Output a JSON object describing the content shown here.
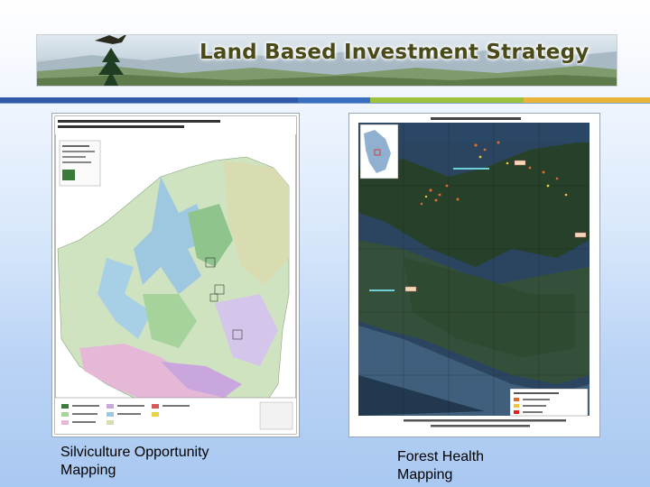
{
  "banner": {
    "title": "Land Based Investment Strategy",
    "logo_icon": "eagle-tree-logo-icon"
  },
  "accent_colors": [
    "#2e5aa8",
    "#3a6fbf",
    "#9fc23c",
    "#e8b53a"
  ],
  "maps": {
    "left": {
      "title": "Potential Expanded Silviculture Opportunities by Leading Species",
      "subtitle": "North Island - Central Coast Forest District - 2011",
      "caption_line1": "Silviculture Opportunity",
      "caption_line2": "Mapping"
    },
    "right": {
      "title": "DRL in South Island Forest District",
      "caption_line1": "Forest Health",
      "caption_line2": "Mapping"
    }
  }
}
